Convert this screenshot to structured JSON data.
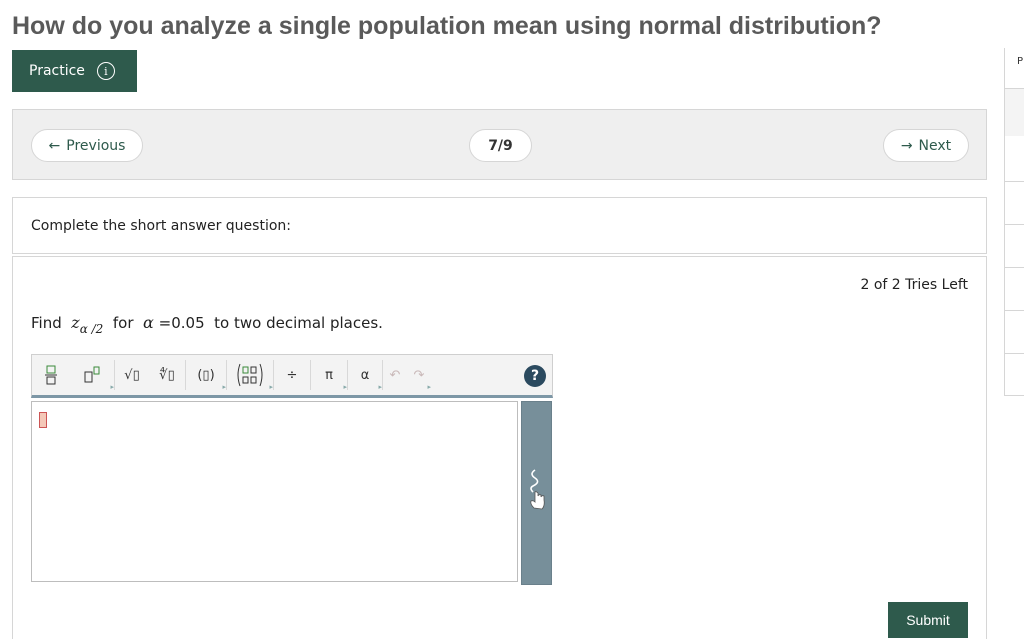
{
  "page": {
    "title": "How do you analyze a single population mean using normal distribution?"
  },
  "practice": {
    "label": "Practice",
    "info_icon": "i"
  },
  "nav": {
    "previous": "Previous",
    "counter": "7/9",
    "next": "Next"
  },
  "instructions": {
    "text": "Complete the short answer question:"
  },
  "question": {
    "tries": "2 of 2 Tries Left",
    "find": "Find",
    "z": "z",
    "z_sub": "α /2",
    "for": "for",
    "alpha": "α",
    "eq": "=",
    "value": "0.05",
    "suffix": "to two decimal places."
  },
  "toolbar": {
    "items": [
      {
        "name": "fraction-icon"
      },
      {
        "name": "superscript-icon"
      },
      {
        "name": "sqrt-icon",
        "glyph": "√▯"
      },
      {
        "name": "nth-root-icon",
        "glyph": "∜▯"
      },
      {
        "name": "parentheses-icon",
        "glyph": "(▯)"
      },
      {
        "name": "matrix-icon"
      },
      {
        "name": "divide-icon",
        "glyph": "÷"
      },
      {
        "name": "pi-icon",
        "glyph": "π"
      },
      {
        "name": "alpha-icon",
        "glyph": "α"
      },
      {
        "name": "undo-icon",
        "glyph": "↶"
      },
      {
        "name": "redo-icon",
        "glyph": "↷"
      }
    ],
    "help": "?"
  },
  "submit": {
    "label": "Submit"
  },
  "side": {
    "letter": "P"
  },
  "colors": {
    "accent": "#2e5a4c",
    "panel": "#efefef",
    "handwriting": "#778f9a"
  }
}
